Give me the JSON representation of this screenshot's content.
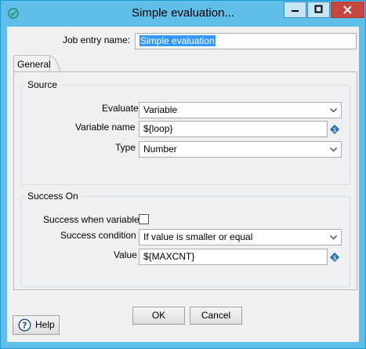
{
  "window": {
    "title": "Simple evaluation..."
  },
  "form": {
    "job_entry_name_label": "Job entry name:",
    "job_entry_name_value": "Simple evaluation"
  },
  "tabs": [
    {
      "label": "General"
    }
  ],
  "source": {
    "group_title": "Source",
    "evaluate_label": "Evaluate",
    "evaluate_value": "Variable",
    "variable_name_label": "Variable name",
    "variable_name_value": "${loop}",
    "type_label": "Type",
    "type_value": "Number"
  },
  "success_on": {
    "group_title": "Success On",
    "success_when_variable_label": "Success when variable",
    "success_when_variable_checked": false,
    "success_condition_label": "Success condition",
    "success_condition_value": "If value is smaller or equal",
    "value_label": "Value",
    "value_value": "${MAXCNT}"
  },
  "buttons": {
    "ok": "OK",
    "cancel": "Cancel",
    "help": "Help"
  },
  "colors": {
    "title_bar": "#5fbfe9",
    "close_button": "#c7463d",
    "selection": "#3399ff",
    "variable_icon": "#1f6fa8"
  }
}
